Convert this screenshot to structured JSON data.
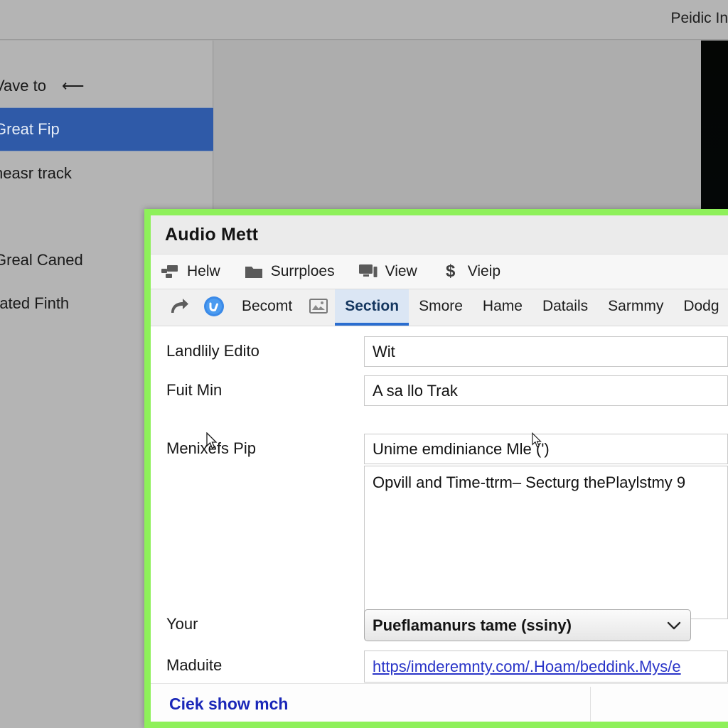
{
  "background": {
    "titlebar": {
      "right_title": "Peidic In"
    },
    "sidebar": {
      "items": [
        {
          "label": "Vave to",
          "icon": "redo-arrow-icon",
          "selected": false
        },
        {
          "label": "Great Fip",
          "selected": true
        },
        {
          "label": "heasr track",
          "selected": false
        },
        {
          "label": "Greal Caned",
          "selected": false
        },
        {
          "label": "rated Finth",
          "selected": false
        }
      ]
    }
  },
  "dialog": {
    "title": "Audio Mett",
    "highlight_color": "#8ef05a",
    "toolbar": [
      {
        "label": "Helw",
        "icon": "layout-icon"
      },
      {
        "label": "Surrploes",
        "icon": "folder-icon"
      },
      {
        "label": "View",
        "icon": "monitor-icon"
      },
      {
        "label": "Vieip",
        "icon": "dollar-icon"
      }
    ],
    "tabs": {
      "leading_icons": [
        {
          "name": "redo-arrow-icon"
        },
        {
          "name": "blue-check-badge-icon"
        }
      ],
      "items": [
        {
          "label": "Becomt",
          "active": false
        },
        {
          "label": "",
          "icon": "image-icon",
          "active": false
        },
        {
          "label": "Section",
          "active": true
        },
        {
          "label": "Smore",
          "active": false
        },
        {
          "label": "Hame",
          "active": false
        },
        {
          "label": "Datails",
          "active": false
        },
        {
          "label": "Sarmmy",
          "active": false
        },
        {
          "label": "Dodg",
          "active": false
        }
      ],
      "active_underline_color": "#2a6dd0",
      "active_background_color": "#dbe6f4"
    },
    "fields": [
      {
        "label": "Landlily Edito",
        "value": "Wit",
        "type": "text"
      },
      {
        "label": "Fuit Min",
        "value": "A sa llo Trak",
        "type": "text"
      },
      {
        "label": "Menixefs Pip",
        "value": "Unime emdiniance Mle (ʹ)",
        "type": "text",
        "textarea_value": "Opvill and Time-ttrm– Secturg thePlaylstmy 9"
      },
      {
        "label": "Your",
        "value": "Pueflamanurs tame (ssiny)",
        "type": "select"
      },
      {
        "label": "Maduite",
        "value": "https/imderemnty.com/.Hoam/beddink.Mys/e",
        "type": "link"
      }
    ],
    "footer": {
      "link_label": "Ciek show mch"
    }
  }
}
